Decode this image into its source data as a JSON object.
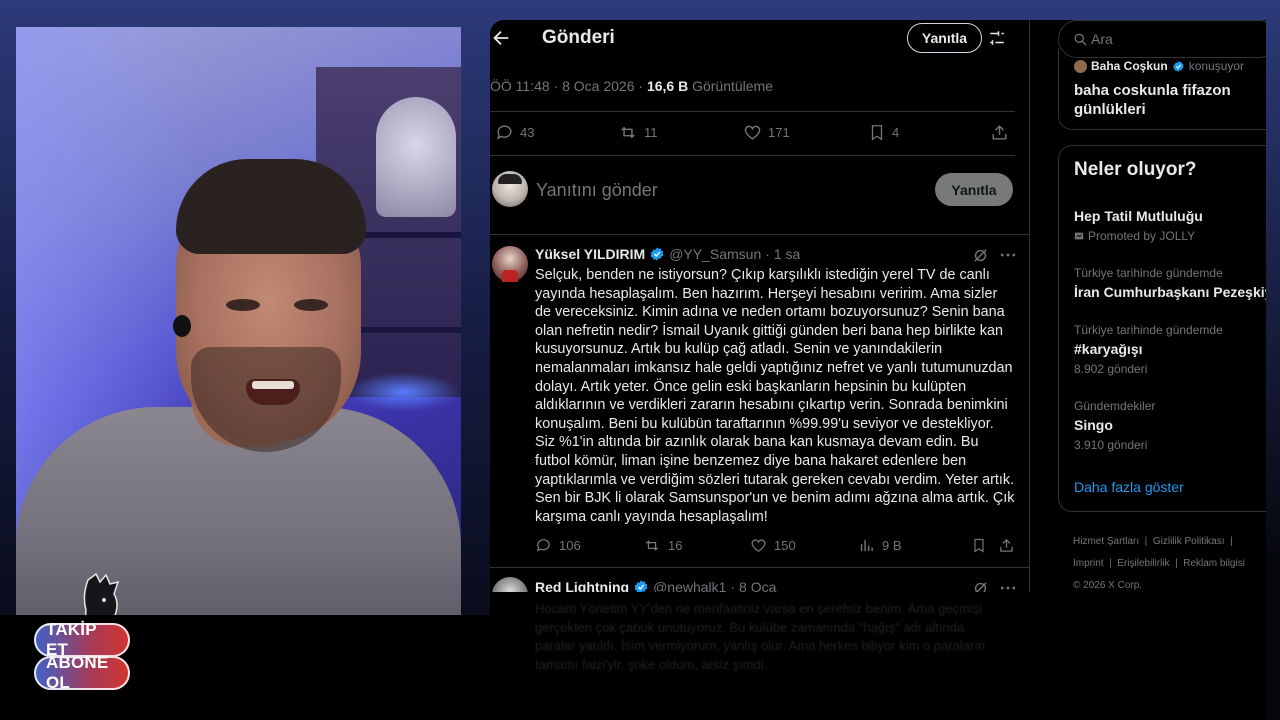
{
  "overlay": {
    "follow_label": "TAKİP ET",
    "subscribe_label": "ABONE OL"
  },
  "post": {
    "header_title": "Gönderi",
    "reply_button": "Yanıtla",
    "timestamp": "ÖÖ 11:48 · 8 Oca 2026 ·",
    "views_count": "16,6 B",
    "views_label": "Görüntüleme",
    "stats": {
      "replies": "43",
      "reposts": "11",
      "likes": "171",
      "bookmarks": "4"
    },
    "reply_placeholder": "Yanıtını gönder",
    "reply_submit": "Yanıtla"
  },
  "reply_tweet": {
    "name": "Yüksel YILDIRIM",
    "handle": "@YY_Samsun",
    "time": "· 1 sa",
    "text": "Selçuk, benden ne istiyorsun? Çıkıp karşılıklı istediğin yerel TV de canlı yayında hesaplaşalım. Ben hazırım. Herşeyi hesabını veririm. Ama sizler de vereceksiniz. Kimin adına ve neden ortamı bozuyorsunuz? Senin bana olan nefretin nedir? İsmail Uyanık gittiği günden beri bana hep birlikte kan kusuyorsunuz. Artık bu kulüp çağ atladı. Senin ve yanındakilerin nemalanmaları imkansız hale geldi yaptığınız nefret ve yanlı tutumunuzdan dolayı. Artık yeter. Önce gelin eski başkanların hepsinin bu kulüpten aldıklarının ve verdikleri zararın hesabını çıkartıp verin. Sonrada benimkini konuşalım. Beni bu kulübün taraftarının %99.99'u seviyor ve destekliyor. Siz %1'in altında bir azınlık olarak bana kan kusmaya devam edin. Bu futbol kömür, liman işine benzemez diye bana hakaret edenlere ben yaptıklarımla ve verdiğim sözleri tutarak gereken cevabı verdim. Yeter artık. Sen bir BJK li olarak Samsunspor'un ve benim adımı ağzına alma artık. Çık karşıma canlı yayında hesaplaşalım!",
    "replies": "106",
    "reposts": "16",
    "likes": "150",
    "views": "9 B"
  },
  "next_tweet": {
    "name": "Red Lightning",
    "handle": "@newhalk1",
    "time": "· 8 Oca",
    "text": "Hocam Yönetim YY'den ne menfaatiniz varsa en şerefsiz benim. Ama geçmişi gerçekten çok çabuk unutuyoruz. Bu kulübe zamanında \"hağış\" adı altında paralar yatıldı. İsim vermiyorum, yanlış olur. Ama herkes biliyor kim o paraların tamamı faizi'ylr, şoke oldum, arsiz şımdi."
  },
  "sidebar": {
    "search_placeholder": "Ara",
    "space": {
      "host": "Baha Coşkun",
      "status": "konuşuyor",
      "title": "baha coskunla fifazon günlükleri"
    },
    "trends_title": "Neler oluyor?",
    "trends": [
      {
        "category": "",
        "name": "Hep Tatil Mutluluğu",
        "sub": "Promoted by JOLLY"
      },
      {
        "category": "Türkiye tarihinde gündemde",
        "name": "İran Cumhurbaşkanı Pezeşkiy",
        "sub": ""
      },
      {
        "category": "Türkiye tarihinde gündemde",
        "name": "#karyağışı",
        "sub": "8.902 gönderi"
      },
      {
        "category": "Gündemdekiler",
        "name": "Singo",
        "sub": "3.910 gönderi"
      }
    ],
    "show_more": "Daha fazla göster",
    "footer": {
      "terms": "Hizmet Şartları",
      "privacy": "Gizlilik Politikası",
      "imprint": "Imprint",
      "accessibility": "Erişilebilirlik",
      "ads": "Reklam bilgisi",
      "copyright": "© 2026 X Corp."
    }
  },
  "colors": {
    "accent_blue": "#1d9bf0",
    "text_primary": "#e7e9ea",
    "text_secondary": "#71767b",
    "border": "#2f3336"
  }
}
